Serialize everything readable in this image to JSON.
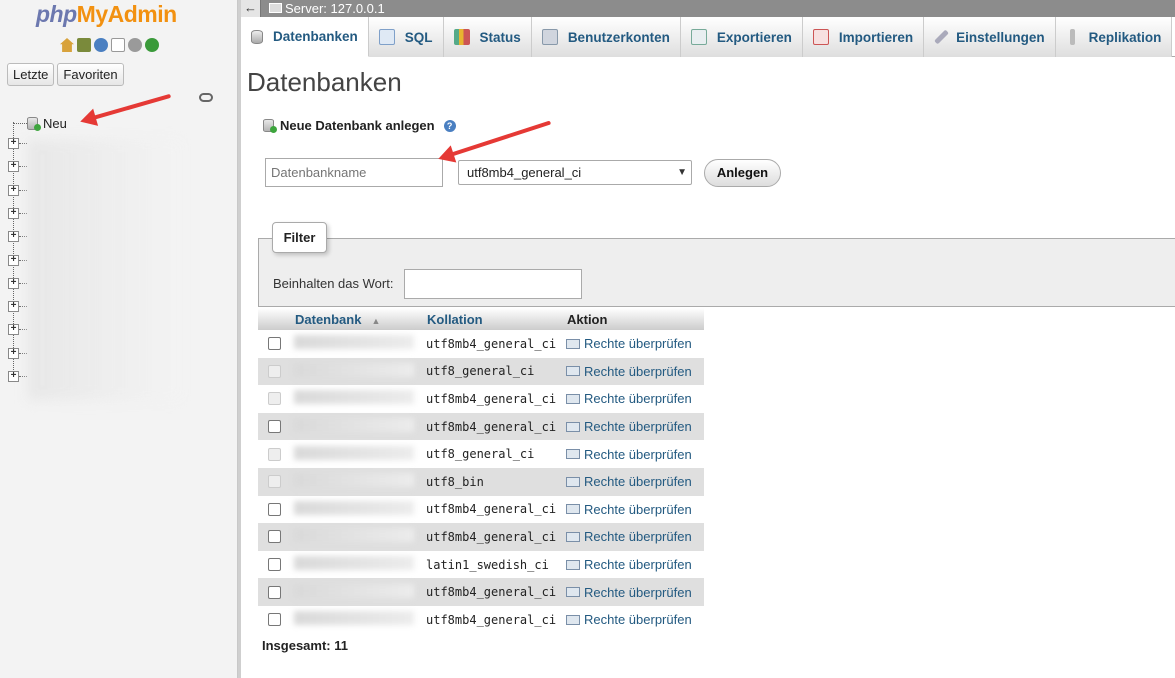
{
  "nav": {
    "logo_php": "php",
    "logo_my": "My",
    "logo_admin": "Admin",
    "icons": [
      "home-icon",
      "exit-icon",
      "help-icon",
      "docs-icon",
      "gear-icon",
      "reload-icon"
    ],
    "recent_label": "Letzte",
    "favorites_label": "Favoriten",
    "new_label": "Neu",
    "tree_count": 11
  },
  "topbar": {
    "back": "←",
    "server_label": "Server: 127.0.0.1"
  },
  "tabs": [
    {
      "label": "Datenbanken",
      "icon": "database-icon",
      "active": true
    },
    {
      "label": "SQL",
      "icon": "sql-icon",
      "active": false
    },
    {
      "label": "Status",
      "icon": "status-icon",
      "active": false
    },
    {
      "label": "Benutzerkonten",
      "icon": "users-icon",
      "active": false
    },
    {
      "label": "Exportieren",
      "icon": "export-icon",
      "active": false
    },
    {
      "label": "Importieren",
      "icon": "import-icon",
      "active": false
    },
    {
      "label": "Einstellungen",
      "icon": "settings-icon",
      "active": false
    },
    {
      "label": "Replikation",
      "icon": "replication-icon",
      "active": false
    }
  ],
  "page": {
    "title": "Datenbanken",
    "create_heading": "Neue Datenbank anlegen",
    "help": "?",
    "dbname_placeholder": "Datenbankname",
    "collation_selected": "utf8mb4_general_ci",
    "create_button": "Anlegen",
    "filter_legend": "Filter",
    "filter_label": "Beinhalten das Wort:"
  },
  "table": {
    "headers": {
      "database": "Datenbank",
      "sort_indicator": "▲",
      "collation": "Kollation",
      "action": "Aktion"
    },
    "rows": [
      {
        "collation": "utf8mb4_general_ci",
        "action": "Rechte überprüfen",
        "checkbox_enabled": true
      },
      {
        "collation": "utf8_general_ci",
        "action": "Rechte überprüfen",
        "checkbox_enabled": false
      },
      {
        "collation": "utf8mb4_general_ci",
        "action": "Rechte überprüfen",
        "checkbox_enabled": false
      },
      {
        "collation": "utf8mb4_general_ci",
        "action": "Rechte überprüfen",
        "checkbox_enabled": true
      },
      {
        "collation": "utf8_general_ci",
        "action": "Rechte überprüfen",
        "checkbox_enabled": false
      },
      {
        "collation": "utf8_bin",
        "action": "Rechte überprüfen",
        "checkbox_enabled": false
      },
      {
        "collation": "utf8mb4_general_ci",
        "action": "Rechte überprüfen",
        "checkbox_enabled": true
      },
      {
        "collation": "utf8mb4_general_ci",
        "action": "Rechte überprüfen",
        "checkbox_enabled": true
      },
      {
        "collation": "latin1_swedish_ci",
        "action": "Rechte überprüfen",
        "checkbox_enabled": true
      },
      {
        "collation": "utf8mb4_general_ci",
        "action": "Rechte überprüfen",
        "checkbox_enabled": true
      },
      {
        "collation": "utf8mb4_general_ci",
        "action": "Rechte überprüfen",
        "checkbox_enabled": true
      }
    ],
    "total_label": "Insgesamt: 11"
  },
  "colors": {
    "link": "#235a81",
    "logo_blue": "#6c78af",
    "logo_orange": "#f29111",
    "annotation_arrow": "#e53935"
  }
}
